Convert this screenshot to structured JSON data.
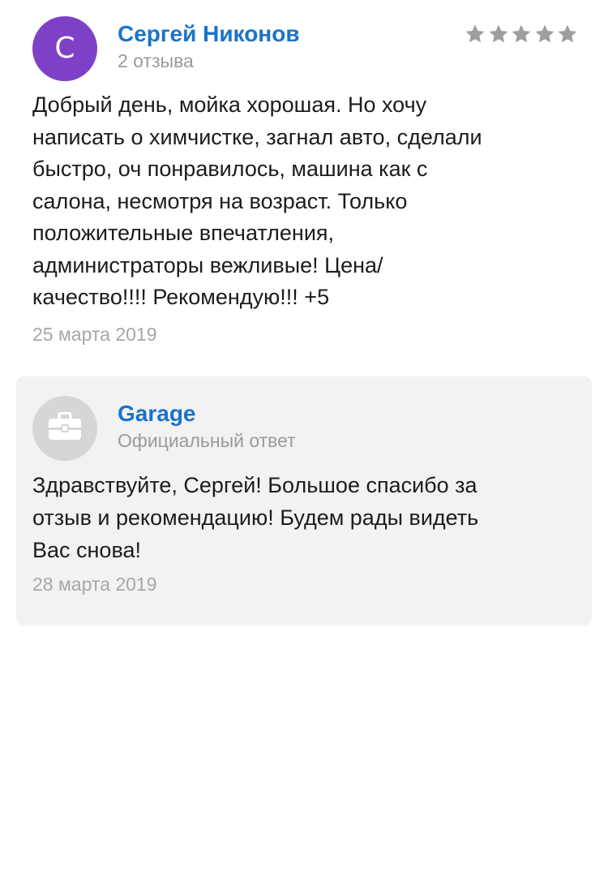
{
  "review": {
    "author": {
      "initial": "С",
      "name": "Сергей Никонов",
      "review_count": "2 отзыва",
      "avatar_color": "#7f40c8"
    },
    "rating": {
      "value": 5,
      "max": 5,
      "star_color": "#9e9e9e"
    },
    "text": "Добрый день, мойка хорошая. Но хочу\nнаписать о химчистке, загнал авто, сделали\nбыстро, оч понравилось, машина как с\nсалона, несмотря на возраст. Только\nположительные впечатления,\nадминистраторы вежливые! Цена/\nкачество!!!! Рекомендую!!! +5",
    "date": "25 марта 2019"
  },
  "reply": {
    "org_name": "Garage",
    "label": "Официальный ответ",
    "icon": "briefcase-icon",
    "text": "Здравствуйте, Сергей! Большое спасибо за\nотзыв и рекомендацию! Будем рады видеть\nВас снова!",
    "date": "28 марта 2019"
  },
  "colors": {
    "link": "#1a73c9",
    "secondary_text": "#9a9a9a",
    "card_background": "#f2f2f2"
  }
}
